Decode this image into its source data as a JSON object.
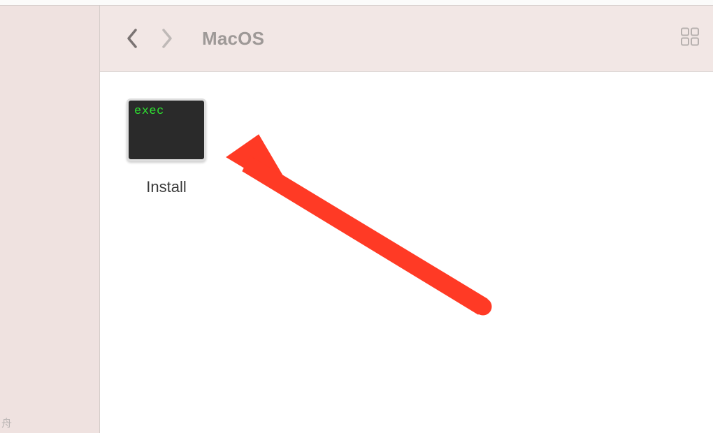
{
  "toolbar": {
    "title": "MacOS"
  },
  "files": [
    {
      "label": "Install",
      "icon_text": "exec"
    }
  ],
  "sidebar": {
    "footer_char": "舟"
  },
  "annotation": {
    "arrow_color": "#ff3a25"
  }
}
